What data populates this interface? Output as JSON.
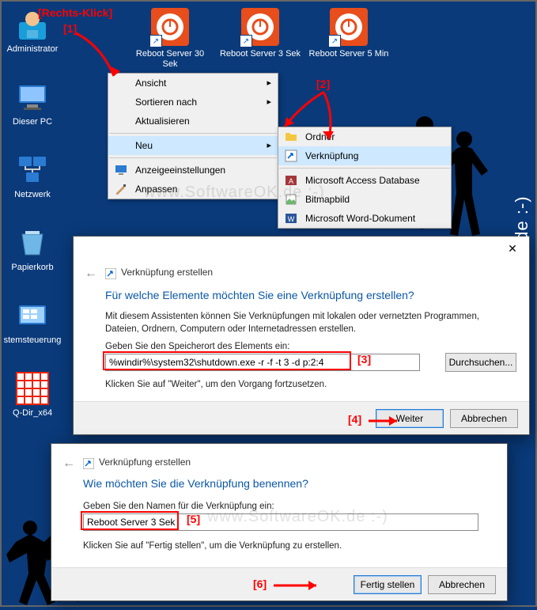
{
  "annotations": {
    "rightClick": "[Rechts-Klick]",
    "n1": "[1]",
    "n2": "[2]",
    "n3": "[3]",
    "n4": "[4]",
    "n5": "[5]",
    "n6": "[6]"
  },
  "watermark": "www.SoftwareOK.de :-)",
  "desktopIcons": {
    "admin": "Administrator",
    "pc": "Dieser PC",
    "net": "Netzwerk",
    "bin": "Papierkorb",
    "ctrl": "stemsteuerung",
    "qdir": "Q-Dir_x64"
  },
  "shortcuts": [
    {
      "label": "Reboot Server 30 Sek"
    },
    {
      "label": "Reboot Server 3 Sek"
    },
    {
      "label": "Reboot Server 5 Min"
    }
  ],
  "contextMenu": {
    "items": {
      "ansicht": "Ansicht",
      "sortieren": "Sortieren nach",
      "aktualisieren": "Aktualisieren",
      "neu": "Neu",
      "anzeige": "Anzeigeeinstellungen",
      "anpassen": "Anpassen"
    },
    "sub": {
      "ordner": "Ordner",
      "verknuepfung": "Verknüpfung",
      "access": "Microsoft Access Database",
      "bitmap": "Bitmapbild",
      "word": "Microsoft Word-Dokument"
    }
  },
  "dialog1": {
    "headerSmall": "Verknüpfung erstellen",
    "title": "Für welche Elemente möchten Sie eine Verknüpfung erstellen?",
    "desc": "Mit diesem Assistenten können Sie Verknüpfungen mit lokalen oder vernetzten Programmen,  Dateien,  Ordnern, Computern oder Internetadressen erstellen.",
    "fieldLabel": "Geben Sie den Speicherort des Elements ein:",
    "fieldValue": "%windir%\\system32\\shutdown.exe -r -f -t 3 -d p:2:4",
    "browse": "Durchsuchen...",
    "hint": "Klicken Sie auf \"Weiter\", um den Vorgang fortzusetzen.",
    "next": "Weiter",
    "cancel": "Abbrechen"
  },
  "dialog2": {
    "headerSmall": "Verknüpfung erstellen",
    "title": "Wie möchten Sie die Verknüpfung benennen?",
    "fieldLabel": "Geben Sie den Namen für die Verknüpfung ein:",
    "fieldValue": "Reboot Server 3 Sek",
    "hint": "Klicken Sie auf \"Fertig stellen\", um die Verknüpfung zu erstellen.",
    "finish": "Fertig stellen",
    "cancel": "Abbrechen"
  }
}
